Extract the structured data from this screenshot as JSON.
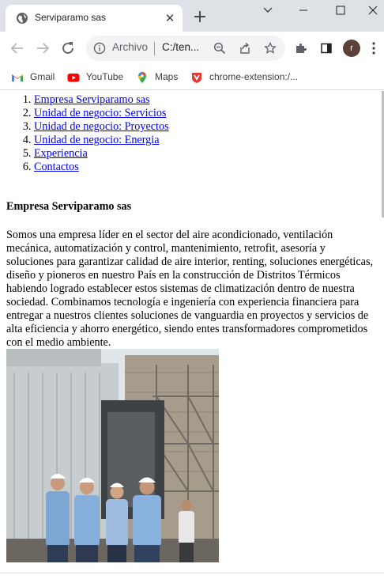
{
  "browser": {
    "tab": {
      "title": "Serviparamo sas"
    },
    "omnibox": {
      "chip_label": "Archivo",
      "url": "C:/ten..."
    },
    "profile_initial": "r",
    "bookmarks": [
      {
        "label": "Gmail",
        "icon": "gmail-icon"
      },
      {
        "label": "YouTube",
        "icon": "youtube-icon"
      },
      {
        "label": "Maps",
        "icon": "maps-icon"
      },
      {
        "label": "chrome-extension:/...",
        "icon": "extension-shield-icon"
      }
    ]
  },
  "page": {
    "nav": [
      "Empresa Serviparamo sas",
      "Unidad de negocio: Servicios",
      "Unidad de negocio: Proyectos",
      "Unidad de negocio: Energia",
      "Experiencia",
      "Contactos"
    ],
    "section_title": "Empresa Serviparamo sas",
    "description": "Somos una empresa líder en el sector del aire acondicionado, ventilación mecánica, automatización y control, mantenimiento, retrofit, asesoría y soluciones para garantizar calidad de aire interior, renting, soluciones energéticas, diseño y pioneros en nuestro País en la construcción de Distritos Térmicos habiendo logrado establecer estos sistemas de climatización dentro de nuestra sociedad. Combinamos tecnología e ingeniería con experiencia financiera para entregar a nuestros clientes soluciones de vanguardia en proyectos y servicios de alta eficiencia y ahorro energético, siendo entes transformadores comprometidos con el medio ambiente."
  },
  "colors": {
    "link": "#0000ee",
    "tabstrip": "#dee1e6",
    "omnibox": "#f1f3f4",
    "avatar": "#5d4037"
  }
}
